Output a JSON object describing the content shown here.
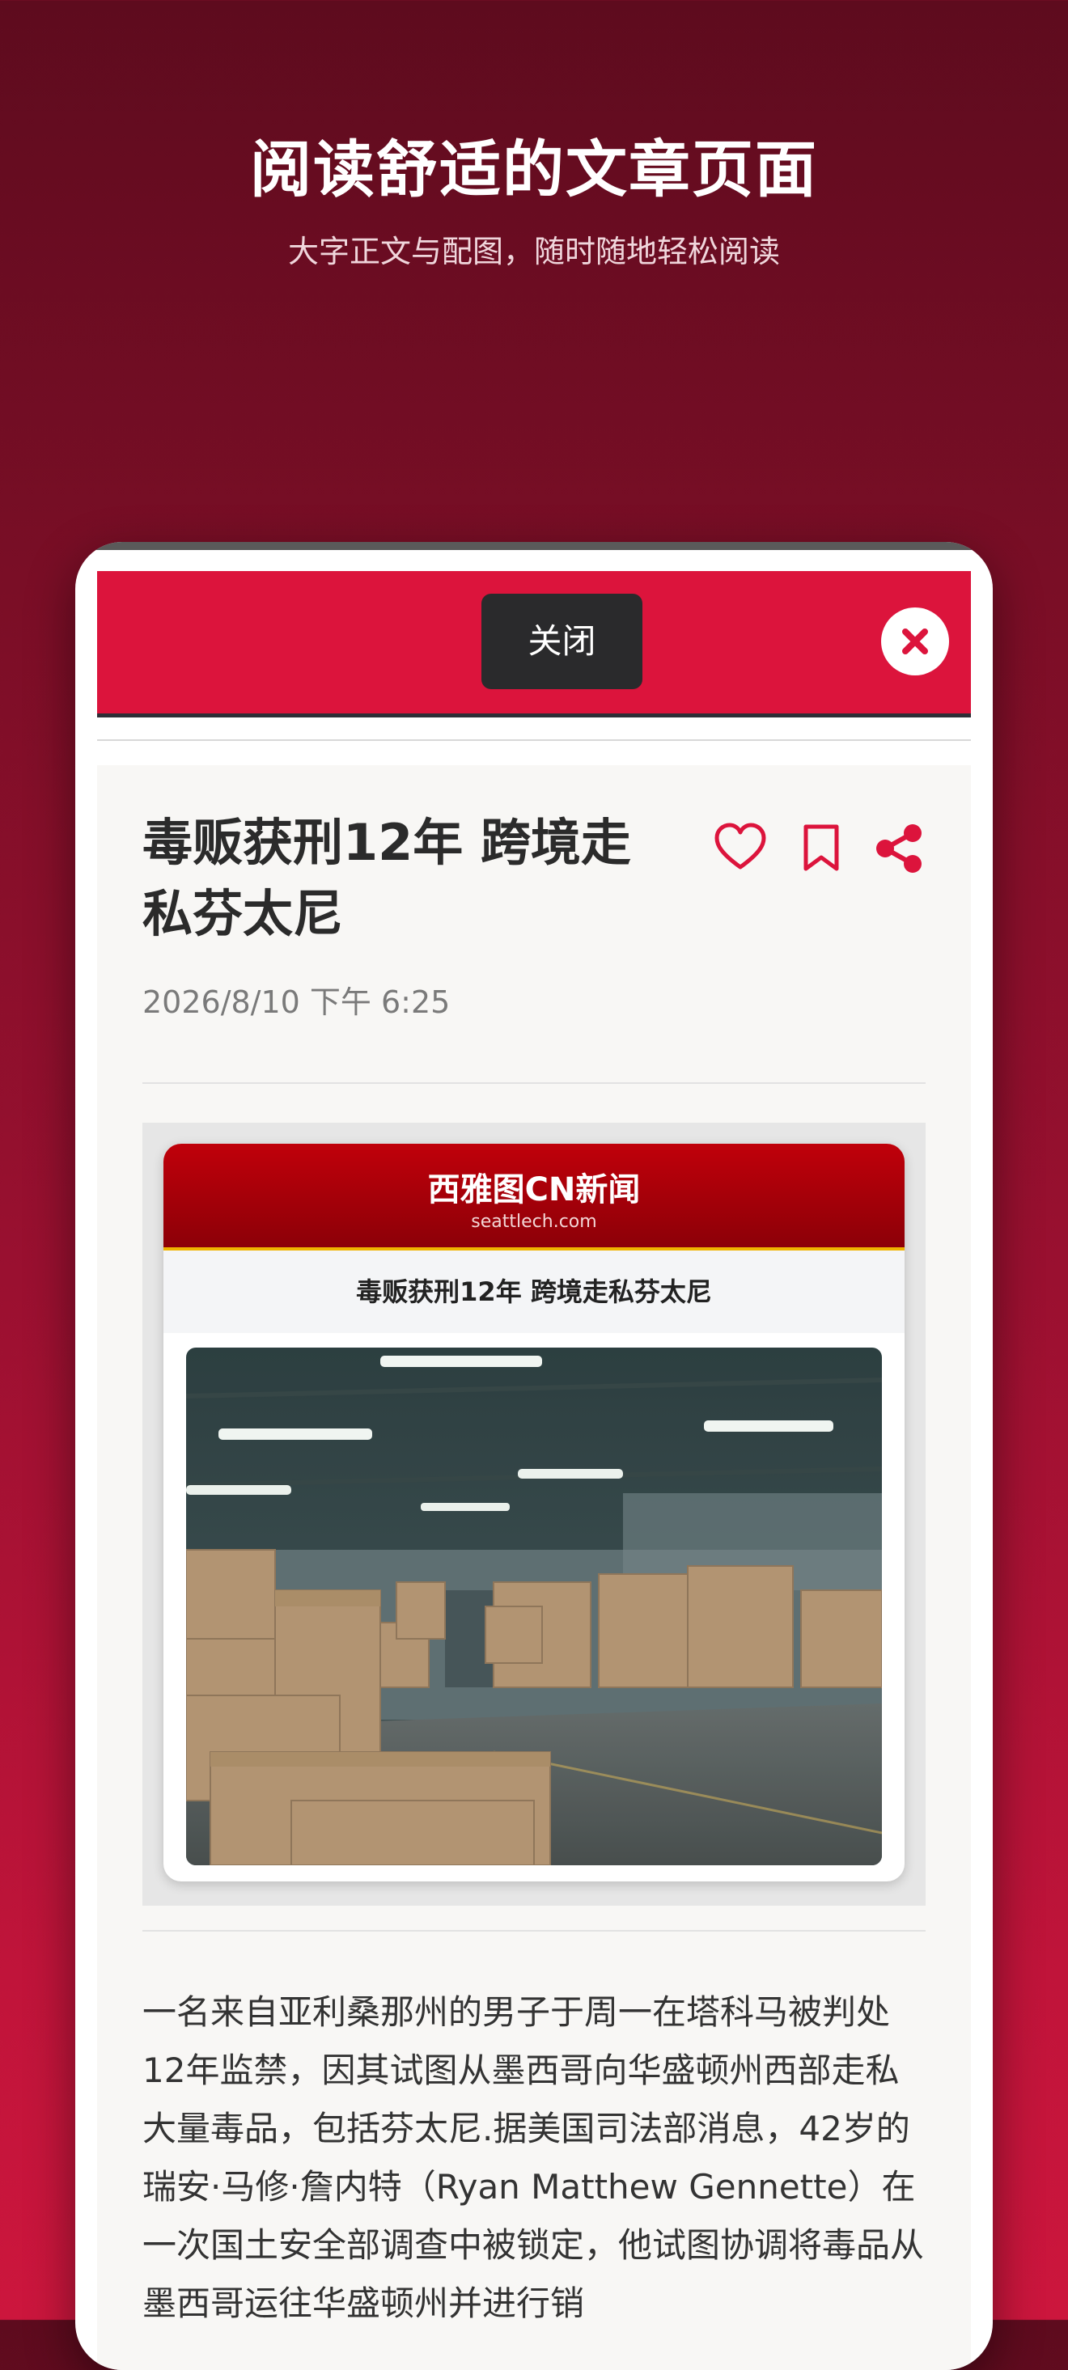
{
  "promo": {
    "title": "阅读舒适的文章页面",
    "subtitle": "大字正文与配图，随时随地轻松阅读"
  },
  "header": {
    "close_label": "关闭",
    "accent_color": "#dc143c"
  },
  "article": {
    "title": "毒贩获刑12年 跨境走私芬太尼",
    "date": "2026/8/10 下午 6:25",
    "actions": [
      "heart-icon",
      "bookmark-icon",
      "share-icon"
    ],
    "image": {
      "brand": "西雅图CN新闻",
      "domain": "seattlech.com",
      "headline": "毒贩获刑12年 跨境走私芬太尼"
    },
    "body": "一名来自亚利桑那州的男子于周一在塔科马被判处12年监禁，因其试图从墨西哥向华盛顿州西部走私大量毒品，包括芬太尼.据美国司法部消息，42岁的瑞安·马修·詹内特（Ryan Matthew Gennette）在一次国土安全部调查中被锁定，他试图协调将毒品从墨西哥运往华盛顿州并进行销"
  }
}
